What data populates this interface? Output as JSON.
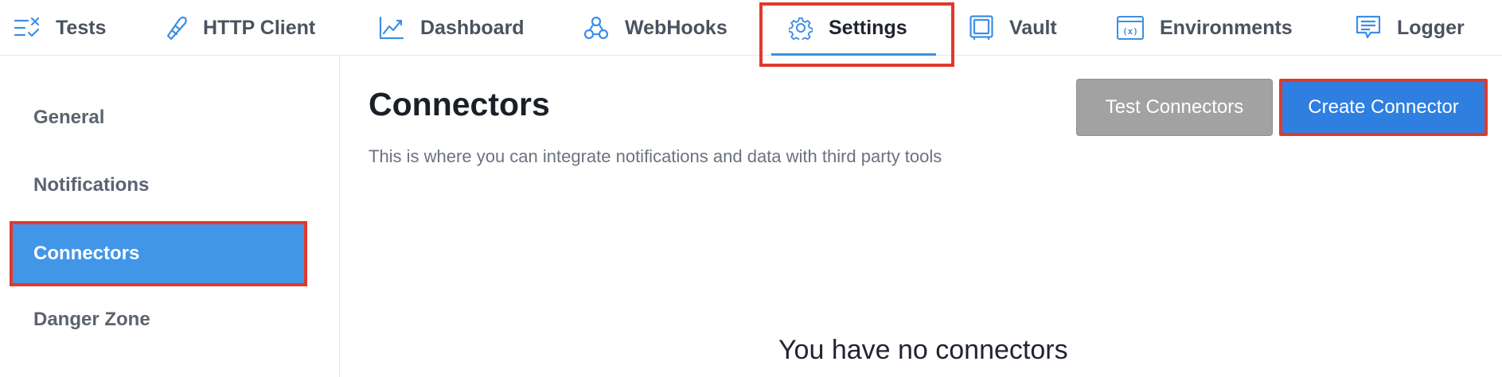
{
  "nav": {
    "items": [
      {
        "label": "Tests",
        "icon": "tests-icon"
      },
      {
        "label": "HTTP Client",
        "icon": "http-client-icon"
      },
      {
        "label": "Dashboard",
        "icon": "dashboard-chart-icon"
      },
      {
        "label": "WebHooks",
        "icon": "webhooks-icon"
      },
      {
        "label": "Settings",
        "icon": "gear-icon",
        "active": true
      },
      {
        "label": "Vault",
        "icon": "vault-icon"
      },
      {
        "label": "Environments",
        "icon": "environment-variable-icon"
      },
      {
        "label": "Logger",
        "icon": "logger-icon"
      }
    ]
  },
  "sidebar": {
    "items": [
      {
        "label": "General"
      },
      {
        "label": "Notifications"
      },
      {
        "label": "Connectors",
        "active": true
      },
      {
        "label": "Danger Zone"
      }
    ]
  },
  "main": {
    "title": "Connectors",
    "subtitle": "This is where you can integrate notifications and data with third party tools",
    "test_button": "Test Connectors",
    "create_button": "Create Connector",
    "empty_message": "You have no connectors"
  },
  "colors": {
    "accent": "#3d8ee6",
    "active_sidebar": "#4196e8",
    "primary_button": "#2f7fe0",
    "secondary_button": "#a2a2a2",
    "highlight_border": "#e0392b"
  }
}
